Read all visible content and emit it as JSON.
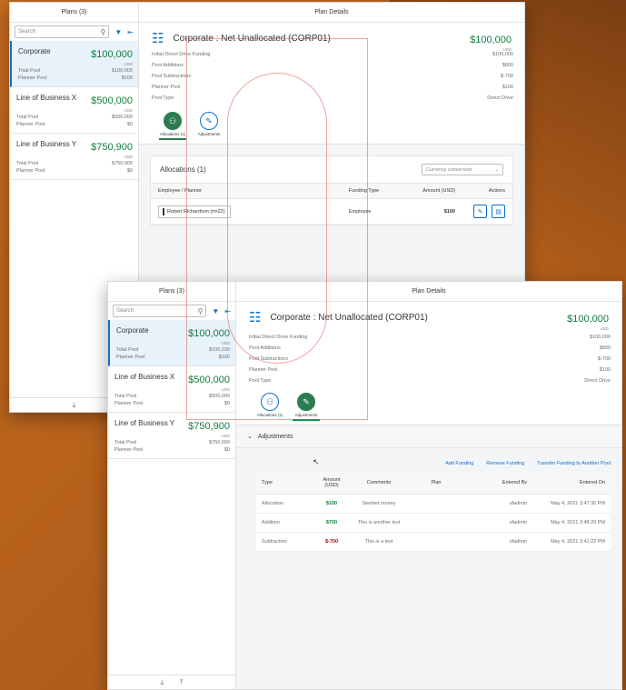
{
  "colors": {
    "background": "#b8611c",
    "accent": "#0a6ed1",
    "positive": "#107e3e",
    "negative": "#bb0000",
    "active_tab": "#2a7d4f"
  },
  "back": {
    "master_title": "Plans (3)",
    "search_placeholder": "Search",
    "plans": [
      {
        "name": "Corporate",
        "amount": "$100,000",
        "currency": "USD",
        "total_pool_label": "Total Pool",
        "total_pool": "$100,000",
        "planner_pool_label": "Planner Pool",
        "planner_pool": "$100"
      },
      {
        "name": "Line of Business X",
        "amount": "$500,000",
        "currency": "USD",
        "total_pool_label": "Total Pool",
        "total_pool": "$500,000",
        "planner_pool_label": "Planner Pool",
        "planner_pool": "$0"
      },
      {
        "name": "Line of Business Y",
        "amount": "$750,900",
        "currency": "USD",
        "total_pool_label": "Total Pool",
        "total_pool": "$750,900",
        "planner_pool_label": "Planner Pool",
        "planner_pool": "$0"
      }
    ],
    "detail_title": "Plan Details",
    "object_title": "Corporate : Net Unallocated (CORP01)",
    "object_amount": "$100,000",
    "object_currency": "USD",
    "attributes": [
      {
        "label": "Initial Direct Drive Funding",
        "value": "$100,000"
      },
      {
        "label": "Pool Additions",
        "value": "$800"
      },
      {
        "label": "Pool Subtractions",
        "value": "$-700"
      },
      {
        "label": "Planner Pool",
        "value": "$100"
      },
      {
        "label": "Pool Type",
        "value": "Direct Drive"
      }
    ],
    "tabs": [
      {
        "label": "Allocations (1)"
      },
      {
        "label": "Adjustments"
      }
    ],
    "allocations": {
      "title": "Allocations (1)",
      "currency_placeholder": "Currency conversion",
      "columns": [
        "Employee / Planner",
        "Funding Type",
        "Amount (USD)",
        "Actions"
      ],
      "rows": [
        {
          "employee": "Robert Richardson (rm22)",
          "funding_type": "Employee",
          "amount": "$100"
        }
      ]
    }
  },
  "front": {
    "master_title": "Plans (3)",
    "search_placeholder": "Search",
    "plans": [
      {
        "name": "Corporate",
        "amount": "$100,000",
        "currency": "USD",
        "total_pool_label": "Total Pool",
        "total_pool": "$100,100",
        "planner_pool_label": "Planner Pool",
        "planner_pool": "$100"
      },
      {
        "name": "Line of Business X",
        "amount": "$500,000",
        "currency": "USD",
        "total_pool_label": "Total Pool",
        "total_pool": "$500,000",
        "planner_pool_label": "Planner Pool",
        "planner_pool": "$0"
      },
      {
        "name": "Line of Business Y",
        "amount": "$750,900",
        "currency": "USD",
        "total_pool_label": "Total Pool",
        "total_pool": "$750,900",
        "planner_pool_label": "Planner Pool",
        "planner_pool": "$0"
      }
    ],
    "detail_title": "Plan Details",
    "object_title": "Corporate : Net Unallocated (CORP01)",
    "object_amount": "$100,000",
    "object_currency": "USD",
    "attributes": [
      {
        "label": "Initial Direct Drive Funding",
        "value": "$100,000"
      },
      {
        "label": "Pool Additions",
        "value": "$800"
      },
      {
        "label": "Pool Subtractions",
        "value": "$-700"
      },
      {
        "label": "Planner Pool",
        "value": "$100"
      },
      {
        "label": "Pool Type",
        "value": "Direct Drive"
      }
    ],
    "tabs": [
      {
        "label": "Allocations (1)"
      },
      {
        "label": "Adjustments"
      }
    ],
    "adjustments": {
      "title": "Adjustments",
      "links": [
        "Add Funding",
        "Remove Funding",
        "Transfer Funding to Another Pool"
      ],
      "columns": [
        "Type",
        "Amount (USD)",
        "Comments",
        "Plan",
        "Entered By",
        "Entered On"
      ],
      "rows": [
        {
          "type": "Allocation",
          "amount": "$100",
          "comments": "Seeded money",
          "plan": "",
          "entered_by": "sfadmin",
          "entered_on": "May 4, 2021 3:47:36 PM"
        },
        {
          "type": "Addition",
          "amount": "$700",
          "comments": "This is another test",
          "plan": "",
          "entered_by": "sfadmin",
          "entered_on": "May 4, 2021 3:48:29 PM"
        },
        {
          "type": "Subtraction",
          "amount": "$-700",
          "comments": "This is a test",
          "plan": "",
          "entered_by": "sfadmin",
          "entered_on": "May 4, 2021 3:41:22 PM"
        }
      ]
    }
  }
}
